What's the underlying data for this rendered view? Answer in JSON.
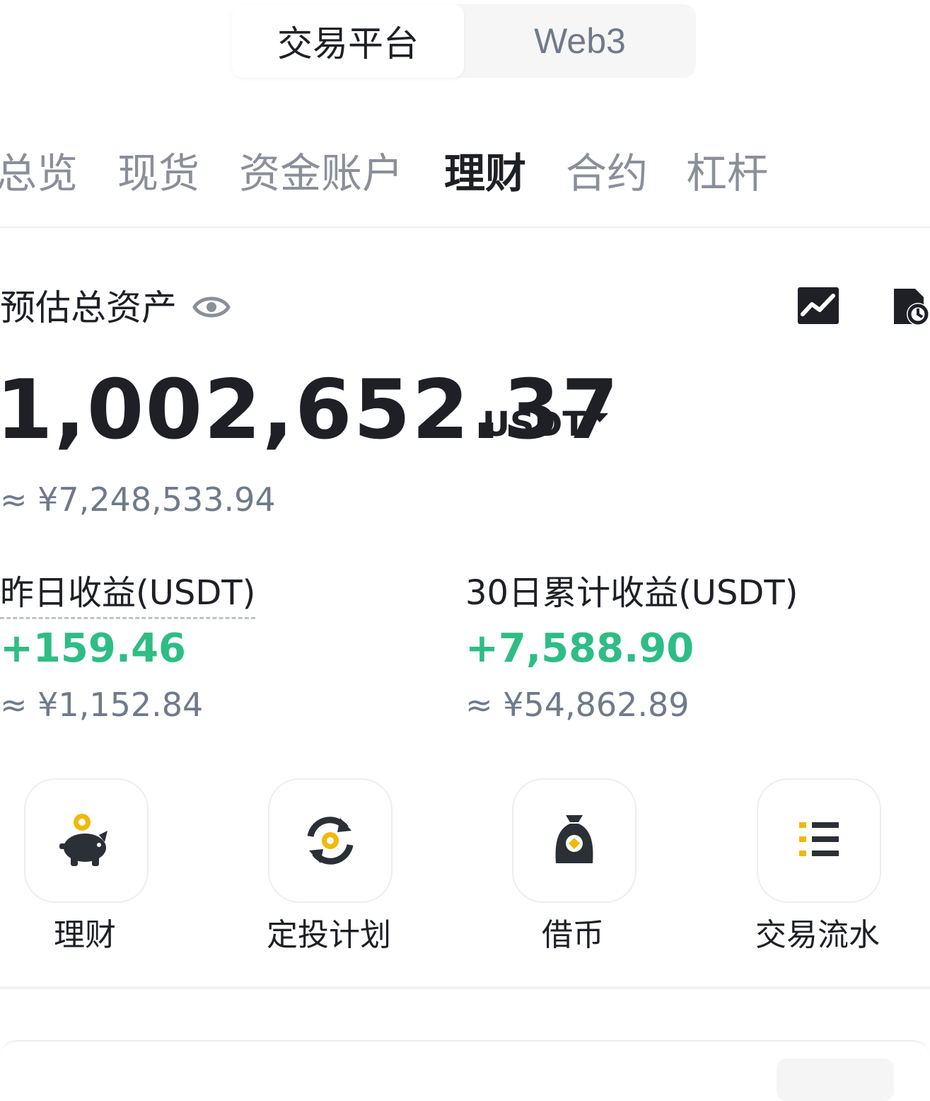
{
  "top_switch": {
    "active": "交易平台",
    "inactive": "Web3"
  },
  "tabs": [
    {
      "label": "总览",
      "active": false
    },
    {
      "label": "现货",
      "active": false
    },
    {
      "label": "资金账户",
      "active": false
    },
    {
      "label": "理财",
      "active": true
    },
    {
      "label": "合约",
      "active": false
    },
    {
      "label": "杠杆",
      "active": false
    }
  ],
  "estimate": {
    "label": "预估总资产",
    "amount": "1,002,652.37",
    "unit": "USDT",
    "cny": "≈ ¥7,248,533.94"
  },
  "earnings": {
    "yesterday": {
      "label": "昨日收益(USDT)",
      "value": "+159.46",
      "cny": "≈ ¥1,152.84"
    },
    "thirty_day": {
      "label": "30日累计收益(USDT)",
      "value": "+7,588.90",
      "cny": "≈ ¥54,862.89"
    }
  },
  "actions": [
    {
      "label": "理财",
      "icon": "piggy-bank-icon"
    },
    {
      "label": "定投计划",
      "icon": "recurring-plan-icon"
    },
    {
      "label": "借币",
      "icon": "loan-bag-icon"
    },
    {
      "label": "交易流水",
      "icon": "list-icon"
    }
  ],
  "colors": {
    "accent_yellow": "#f0b90b",
    "positive_green": "#2ebd85",
    "text_primary": "#1e2026",
    "text_secondary": "#707a8a"
  }
}
